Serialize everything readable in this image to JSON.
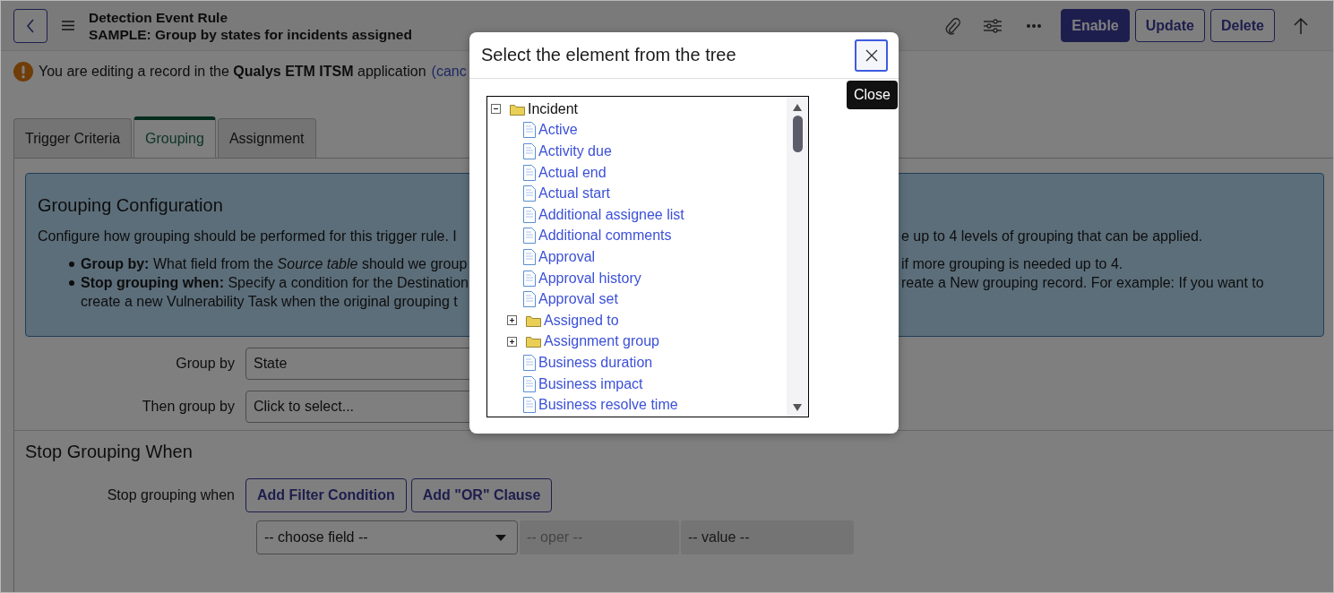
{
  "header": {
    "title": "Detection Event Rule",
    "subtitle": "SAMPLE: Group by states for incidents assigned",
    "buttons": [
      {
        "label": "Enable",
        "kind": "primary"
      },
      {
        "label": "Update",
        "kind": "outline"
      },
      {
        "label": "Delete",
        "kind": "outline"
      }
    ]
  },
  "notice": {
    "text": "You are editing a record in the **Qualys ETM ITSM** application",
    "link": "(canc"
  },
  "tabs": [
    {
      "label": "Trigger Criteria",
      "selected": false
    },
    {
      "label": "Grouping",
      "selected": true
    },
    {
      "label": "Assignment",
      "selected": false
    }
  ],
  "info_box": {
    "title": "Grouping Configuration",
    "lines": [
      {
        "kind": "text",
        "left": "Configure how grouping should be performed for this trigger rule. I",
        "right": "e up to 4 levels of grouping that can be applied."
      },
      {
        "kind": "bullet",
        "left": "**Group by:** What field from the *Source table* should we group",
        "right": "if more grouping is needed up to 4."
      },
      {
        "kind": "bullet",
        "left": "**Stop grouping when:** Specify a condition for the Destination",
        "right": "reate a New grouping record. For example: If you want to"
      },
      {
        "kind": "continuation",
        "left": "create a new Vulnerability Task when the original grouping t"
      }
    ]
  },
  "fields": [
    {
      "label": "Group by",
      "value": "State"
    },
    {
      "label": "Then group by",
      "value": "Click to select..."
    }
  ],
  "stop_section": {
    "title": "Stop Grouping When",
    "label": "Stop grouping when",
    "buttons": [
      "Add Filter Condition",
      "Add \"OR\" Clause"
    ],
    "filter": [
      {
        "text": "-- choose field --",
        "disabled": false
      },
      {
        "text": "-- oper --",
        "disabled": true
      },
      {
        "text": "-- value --",
        "disabled": true
      }
    ]
  },
  "modal": {
    "title": "Select the element from the tree",
    "close_tooltip": "Close",
    "tree": [
      {
        "label": "Incident",
        "kind": "folder",
        "expanded": true,
        "children": [
          {
            "label": "Active",
            "kind": "field"
          },
          {
            "label": "Activity due",
            "kind": "field"
          },
          {
            "label": "Actual end",
            "kind": "field"
          },
          {
            "label": "Actual start",
            "kind": "field"
          },
          {
            "label": "Additional assignee list",
            "kind": "field"
          },
          {
            "label": "Additional comments",
            "kind": "field"
          },
          {
            "label": "Approval",
            "kind": "field"
          },
          {
            "label": "Approval history",
            "kind": "field"
          },
          {
            "label": "Approval set",
            "kind": "field"
          },
          {
            "label": "Assigned to",
            "kind": "folder",
            "expanded": false
          },
          {
            "label": "Assignment group",
            "kind": "folder",
            "expanded": false
          },
          {
            "label": "Business duration",
            "kind": "field"
          },
          {
            "label": "Business impact",
            "kind": "field"
          },
          {
            "label": "Business resolve time",
            "kind": "field"
          }
        ]
      }
    ]
  }
}
